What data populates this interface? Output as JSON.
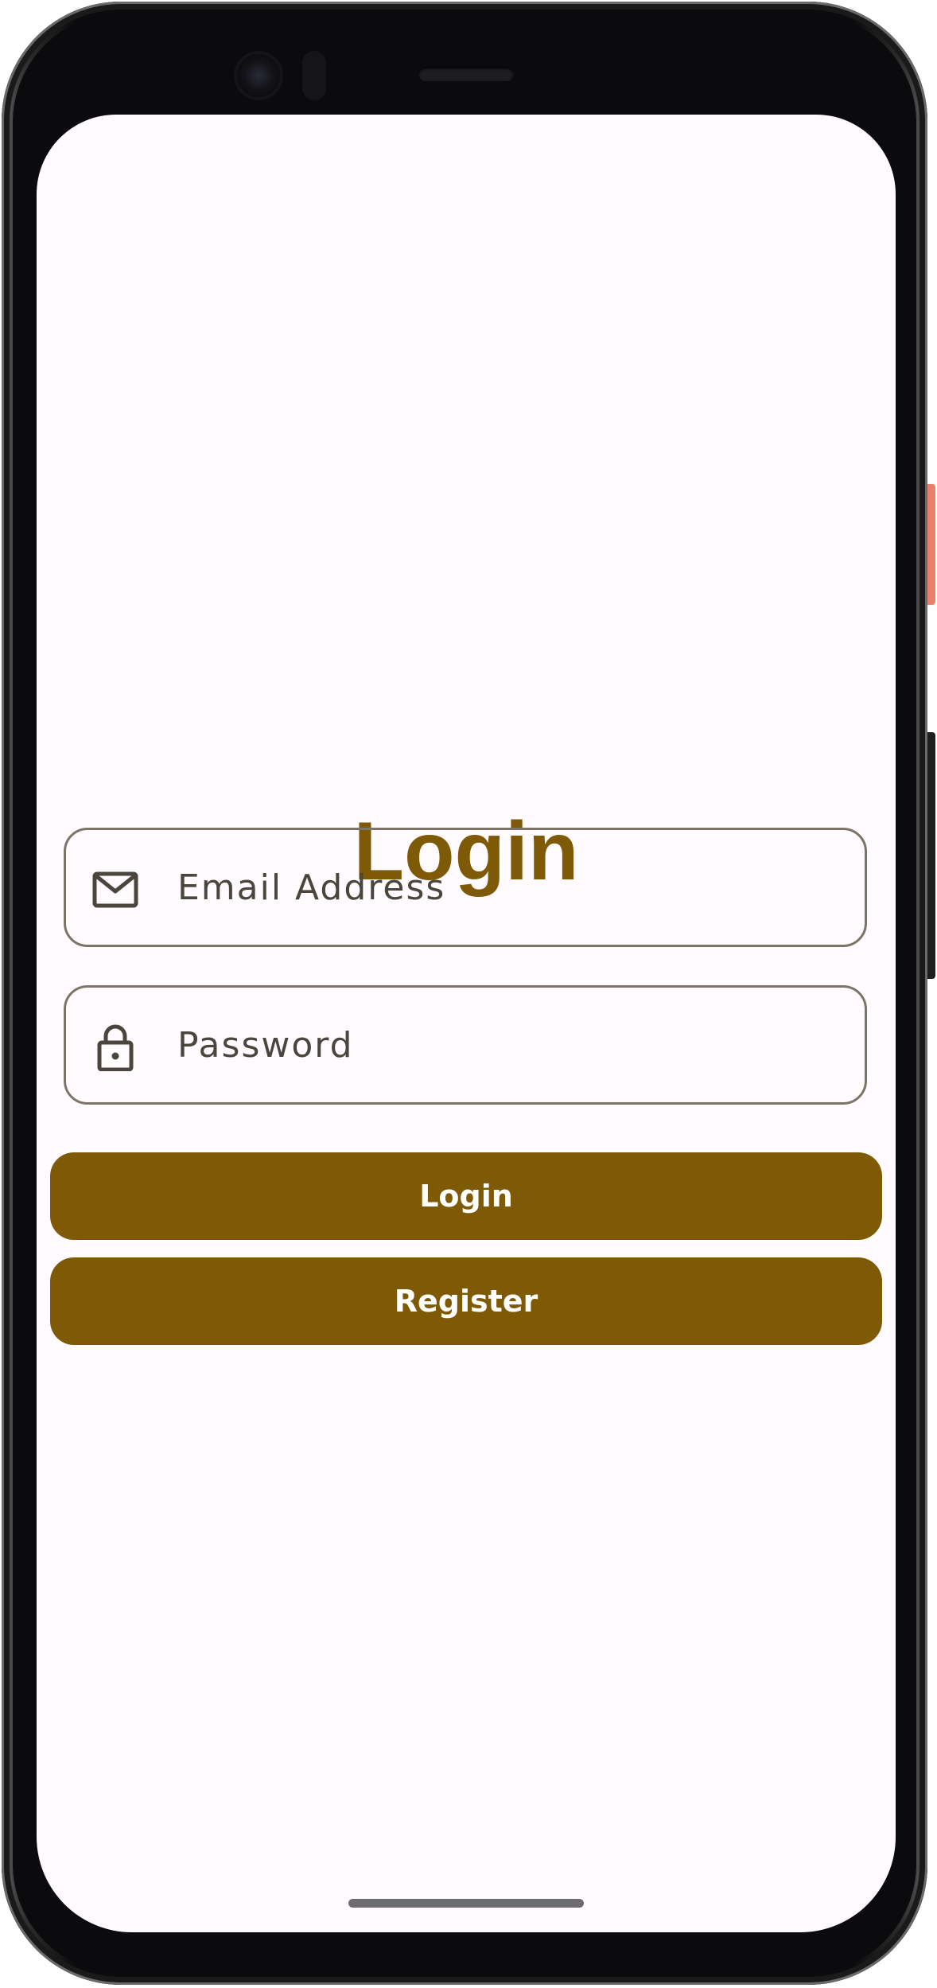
{
  "screen": {
    "title": "Login"
  },
  "email_field": {
    "icon": "envelope-icon",
    "placeholder": "Email Address",
    "value": ""
  },
  "password_field": {
    "icon": "lock-icon",
    "placeholder": "Password",
    "value": ""
  },
  "buttons": {
    "login_label": "Login",
    "register_label": "Register"
  },
  "colors": {
    "accent": "#7f5a06",
    "background": "#fffbfe",
    "outline": "#7b7467",
    "text": "#4a463d"
  }
}
